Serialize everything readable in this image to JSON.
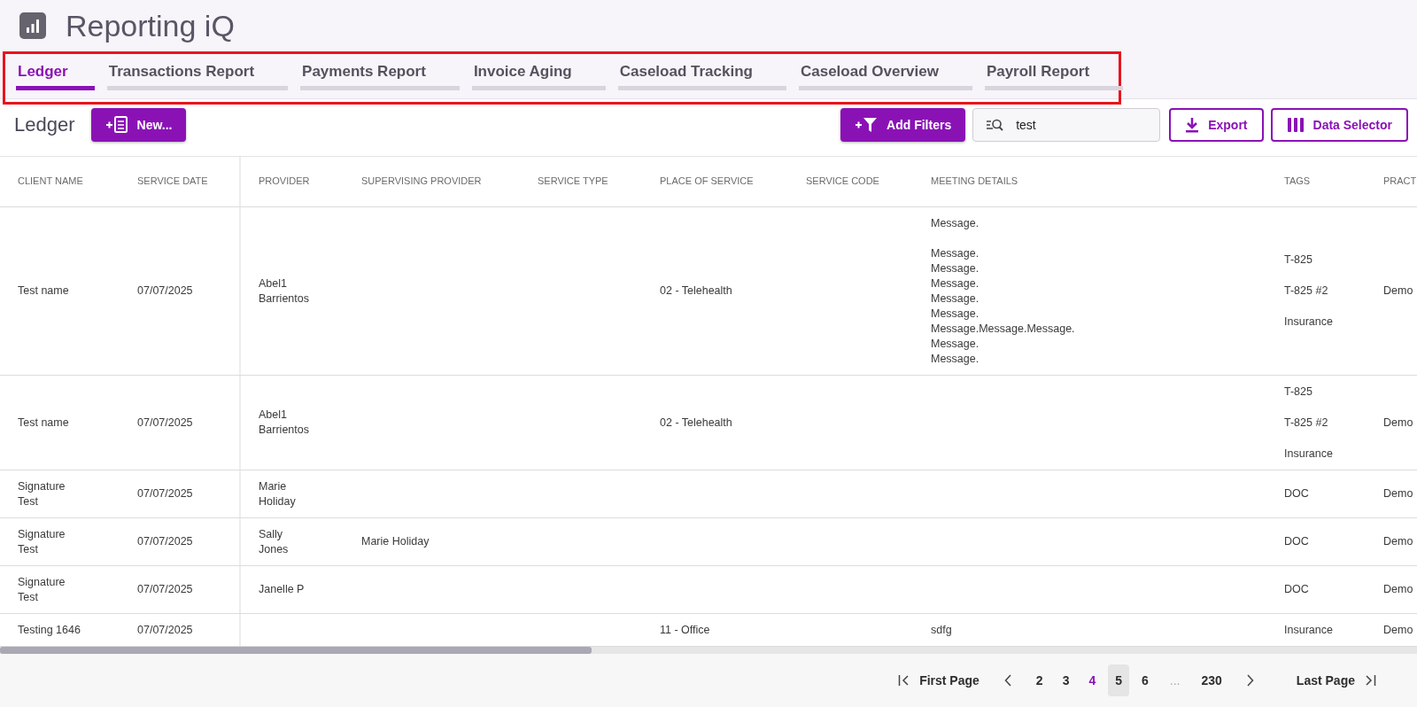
{
  "app": {
    "title": "Reporting iQ"
  },
  "tabs": [
    {
      "label": "Ledger",
      "selected": true
    },
    {
      "label": "Transactions Report",
      "selected": false
    },
    {
      "label": "Payments Report",
      "selected": false
    },
    {
      "label": "Invoice Aging",
      "selected": false
    },
    {
      "label": "Caseload Tracking",
      "selected": false
    },
    {
      "label": "Caseload Overview",
      "selected": false
    },
    {
      "label": "Payroll Report",
      "selected": false
    }
  ],
  "toolbar": {
    "title": "Ledger",
    "new_button": "New...",
    "add_filters_button": "Add Filters",
    "search": {
      "value": "test"
    },
    "export_button": "Export",
    "data_selector_button": "Data Selector"
  },
  "table": {
    "columns": [
      "CLIENT NAME",
      "SERVICE DATE",
      "PROVIDER",
      "SUPERVISING PROVIDER",
      "SERVICE TYPE",
      "PLACE OF SERVICE",
      "SERVICE CODE",
      "MEETING DETAILS",
      "TAGS",
      "PRACT"
    ],
    "rows": [
      {
        "client_name": "Test name",
        "service_date": "07/07/2025",
        "provider": "Abel1\nBarrientos",
        "place_of_service": "02 - Telehealth",
        "meeting_details": "Message.\n\nMessage.\nMessage.\nMessage.\nMessage.\nMessage.\nMessage.Message.Message.\nMessage.\nMessage.",
        "tags": [
          "T-825",
          "T-825 #2",
          "Insurance"
        ],
        "column_10": "Demo"
      },
      {
        "client_name": "Test name",
        "service_date": "07/07/2025",
        "provider": "Abel1\nBarrientos",
        "place_of_service": "02 - Telehealth",
        "tags": [
          "T-825",
          "T-825 #2",
          "Insurance"
        ],
        "column_10": "Demo"
      },
      {
        "client_name": "Signature\nTest",
        "service_date": "07/07/2025",
        "provider": "Marie\nHoliday",
        "tags": [
          "DOC"
        ],
        "column_10": "Demo"
      },
      {
        "client_name": "Signature\nTest",
        "service_date": "07/07/2025",
        "provider": "Sally\nJones",
        "supervising_provider": "Marie Holiday",
        "tags": [
          "DOC"
        ],
        "column_10": "Demo"
      },
      {
        "client_name": "Signature\nTest",
        "service_date": "07/07/2025",
        "provider": "Janelle P",
        "tags": [
          "DOC"
        ],
        "column_10": "Demo"
      },
      {
        "client_name": "Testing 1646",
        "service_date": "07/07/2025",
        "place_of_service": "11 - Office",
        "meeting_details": "sdfg",
        "tags": [
          "Insurance"
        ],
        "column_10": "Demo"
      }
    ]
  },
  "pagination": {
    "first": "First Page",
    "last": "Last Page",
    "pages": [
      {
        "kind": "page",
        "label": "2",
        "selected": false,
        "highlighted": false
      },
      {
        "kind": "page",
        "label": "3",
        "selected": false,
        "highlighted": false
      },
      {
        "kind": "page",
        "label": "4",
        "selected": true,
        "highlighted": false
      },
      {
        "kind": "page",
        "label": "5",
        "selected": false,
        "highlighted": true
      },
      {
        "kind": "page",
        "label": "6",
        "selected": false,
        "highlighted": false
      },
      {
        "kind": "ellipsis",
        "label": "..."
      },
      {
        "kind": "page",
        "label": "230",
        "selected": false,
        "highlighted": false
      }
    ]
  }
}
